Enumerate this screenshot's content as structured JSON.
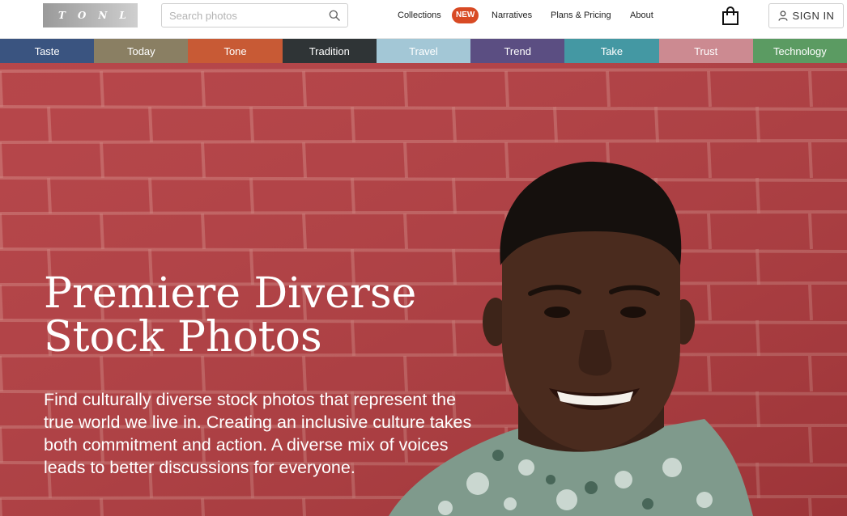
{
  "header": {
    "logo_text": "TONL",
    "search": {
      "placeholder": "Search photos",
      "value": ""
    },
    "nav": {
      "collections": "Collections",
      "collections_badge": "NEW",
      "narratives": "Narratives",
      "plans_pricing": "Plans & Pricing",
      "about": "About"
    },
    "signin_label": "SIGN IN"
  },
  "categories": [
    {
      "label": "Taste",
      "color": "#3a5480"
    },
    {
      "label": "Today",
      "color": "#8a7f63"
    },
    {
      "label": "Tone",
      "color": "#c85a35"
    },
    {
      "label": "Tradition",
      "color": "#2f3436"
    },
    {
      "label": "Travel",
      "color": "#a3c7d6"
    },
    {
      "label": "Trend",
      "color": "#5b4e82"
    },
    {
      "label": "Take",
      "color": "#4498a3"
    },
    {
      "label": "Trust",
      "color": "#cc8a91"
    },
    {
      "label": "Technology",
      "color": "#5b9b62"
    }
  ],
  "hero": {
    "title": "Premiere Diverse\nStock Photos",
    "description": "Find culturally diverse stock photos that represent the true world we live in. Creating an inclusive culture takes both commitment and action. A diverse mix of voices leads to better discussions for everyone."
  },
  "colors": {
    "accent": "#d84a24",
    "brick": "#b0393e"
  }
}
